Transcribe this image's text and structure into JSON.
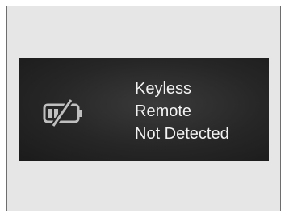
{
  "display": {
    "icon": "remote-battery-crossed-icon",
    "message_lines": [
      "Keyless",
      "Remote",
      "Not Detected"
    ]
  },
  "colors": {
    "page_background": "#e6e6e6",
    "display_background": "#262626",
    "text": "#f2f2f2",
    "icon": "#bfbfbf"
  }
}
